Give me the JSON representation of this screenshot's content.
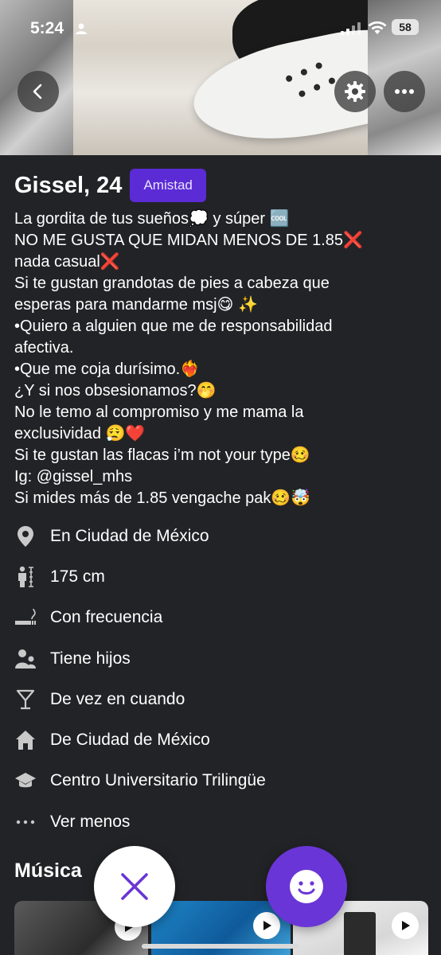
{
  "status_bar": {
    "time": "5:24",
    "battery": "58"
  },
  "profile": {
    "name_age": "Gissel, 24",
    "badge": "Amistad"
  },
  "bio": [
    "La gordita de tus sueños💭 y súper 🆒",
    "NO ME GUSTA QUE MIDAN MENOS DE 1.85❌",
    "nada casual❌",
    "Si te gustan grandotas de pies a cabeza que",
    "esperas para mandarme msj😋 ✨",
    "•Quiero a alguien que me de responsabilidad",
    "afectiva.",
    "•Que me coja durísimo.❤️‍🔥",
    "¿Y si nos obsesionamos?🤭",
    "No le temo al compromiso y me mama la",
    "exclusividad 😮‍💨❤️",
    "Si te gustan las flacas i’m not your type🥴",
    "Ig: @gissel_mhs",
    "Si mides más de 1.85 vengache pak🥴🤯"
  ],
  "details": [
    {
      "icon": "location-pin-icon",
      "text": "En Ciudad de México"
    },
    {
      "icon": "height-icon",
      "text": "175 cm"
    },
    {
      "icon": "smoking-icon",
      "text": "Con frecuencia"
    },
    {
      "icon": "children-icon",
      "text": "Tiene hijos"
    },
    {
      "icon": "cocktail-icon",
      "text": "De vez en cuando"
    },
    {
      "icon": "home-icon",
      "text": "De Ciudad de México"
    },
    {
      "icon": "graduation-icon",
      "text": "Centro Universitario Trilingüe"
    },
    {
      "icon": "more-dots-icon",
      "text": "Ver menos"
    }
  ],
  "music": {
    "title": "Música"
  },
  "colors": {
    "background": "#222326",
    "badge": "#5b2bd6",
    "like": "#6a35d6",
    "dislike_icon": "#6a35d6"
  }
}
